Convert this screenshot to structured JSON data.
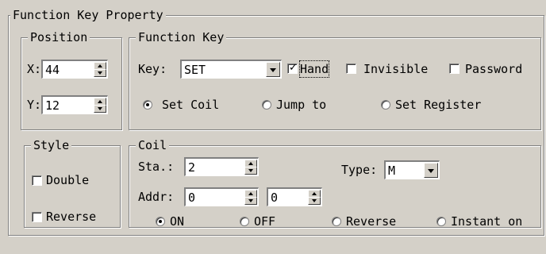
{
  "outer": {
    "legend": "Function Key Property"
  },
  "position": {
    "legend": "Position",
    "x_label": "X:",
    "x_value": "44",
    "y_label": "Y:",
    "y_value": "12"
  },
  "function_key": {
    "legend": "Function Key",
    "key_label": "Key:",
    "key_value": "SET",
    "hand_label": "Hand",
    "hand_checked": true,
    "invisible_label": "Invisible",
    "invisible_checked": false,
    "password_label": "Password",
    "password_checked": false,
    "radios": [
      {
        "label": "Set Coil",
        "selected": true
      },
      {
        "label": "Jump to",
        "selected": false
      },
      {
        "label": "Set Register",
        "selected": false
      }
    ]
  },
  "style": {
    "legend": "Style",
    "double_label": "Double",
    "double_checked": false,
    "reverse_label": "Reverse",
    "reverse_checked": false
  },
  "coil": {
    "legend": "Coil",
    "sta_label": "Sta.:",
    "sta_value": "2",
    "type_label": "Type:",
    "type_value": "M",
    "addr_label": "Addr:",
    "addr_value1": "0",
    "addr_value2": "0",
    "radios": [
      {
        "label": "ON",
        "selected": true
      },
      {
        "label": "OFF",
        "selected": false
      },
      {
        "label": "Reverse",
        "selected": false
      },
      {
        "label": "Instant on",
        "selected": false
      }
    ]
  }
}
